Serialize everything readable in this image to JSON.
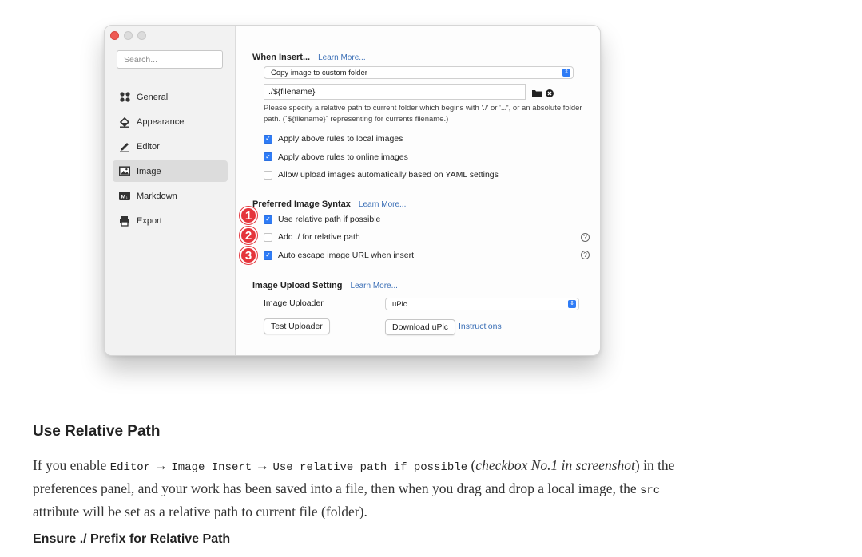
{
  "window": {
    "sidebar": {
      "search_placeholder": "Search...",
      "items": [
        {
          "label": "General",
          "icon": "grid-icon"
        },
        {
          "label": "Appearance",
          "icon": "paint-bucket-icon"
        },
        {
          "label": "Editor",
          "icon": "pen-icon"
        },
        {
          "label": "Image",
          "icon": "image-icon",
          "active": true
        },
        {
          "label": "Markdown",
          "icon": "markdown-icon"
        },
        {
          "label": "Export",
          "icon": "printer-icon"
        }
      ]
    },
    "when_insert": {
      "title": "When Insert...",
      "learn_more": "Learn More...",
      "action_select": "Copy image to custom folder",
      "path_value": "./${filename}",
      "hint": "Please specify a relative path to current folder which begins with './' or '../', or an absolute folder path. (`${filename}` representing for currents filename.)",
      "checks": [
        {
          "label": "Apply above rules to local images",
          "checked": true
        },
        {
          "label": "Apply above rules to online images",
          "checked": true
        },
        {
          "label": "Allow upload images automatically based on YAML settings",
          "checked": false
        }
      ]
    },
    "syntax": {
      "title": "Preferred Image Syntax",
      "learn_more": "Learn More...",
      "options": [
        {
          "badge": "1",
          "label": "Use relative path if possible",
          "checked": true,
          "help": false
        },
        {
          "badge": "2",
          "label": "Add ./ for relative path",
          "checked": false,
          "help": true
        },
        {
          "badge": "3",
          "label": "Auto escape image URL when insert",
          "checked": true,
          "help": true
        }
      ]
    },
    "upload": {
      "title": "Image Upload Setting",
      "learn_more": "Learn More...",
      "uploader_label": "Image Uploader",
      "uploader_value": "uPic",
      "test_button": "Test Uploader",
      "download_button": "Download uPic",
      "instructions": "Instructions"
    }
  },
  "article": {
    "heading": "Use Relative Path",
    "p_lead": "If you enable",
    "code_editor": "Editor",
    "arrow1": "→",
    "code_image_insert": "Image Insert",
    "arrow2": "→",
    "code_use_relative": "Use relative path if possible",
    "paren_open": "(",
    "italic_note": "checkbox No.1 in screenshot",
    "paren_close": ")",
    "p_mid": "in the preferences panel, and your work has been saved into a file, then when you drag and drop a local image, the",
    "code_src": "src",
    "p_end": "attribute will be set as a relative path to current file (folder).",
    "subheading": "Ensure ./ Prefix for Relative Path"
  },
  "colors": {
    "accent": "#2f7cf6",
    "badge_red": "#e5353c",
    "link_blue": "#3b6fb6"
  }
}
